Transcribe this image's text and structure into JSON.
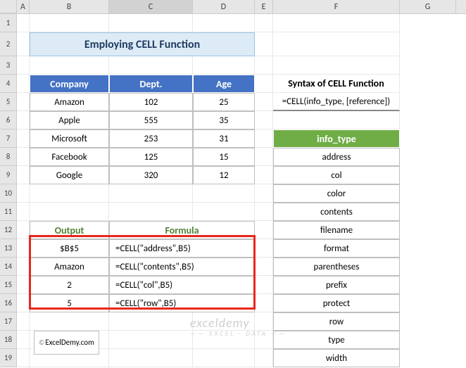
{
  "columns": [
    "A",
    "B",
    "C",
    "D",
    "E",
    "F",
    "G"
  ],
  "activeCol": "C",
  "rows": [
    "1",
    "2",
    "3",
    "4",
    "5",
    "6",
    "7",
    "8",
    "9",
    "10",
    "11",
    "12",
    "13",
    "14",
    "15",
    "16",
    "17",
    "18",
    "19"
  ],
  "title": "Employing CELL Function",
  "table1": {
    "headers": [
      "Company",
      "Dept.",
      "Age"
    ],
    "rows": [
      [
        "Amazon",
        "102",
        "25"
      ],
      [
        "Apple",
        "555",
        "35"
      ],
      [
        "Microsoft",
        "253",
        "31"
      ],
      [
        "Facebook",
        "125",
        "15"
      ],
      [
        "Google",
        "320",
        "12"
      ]
    ]
  },
  "syntax": {
    "title": "Syntax of CELL Function",
    "formula": "=CELL(info_type, [reference])"
  },
  "infoType": {
    "header": "info_type",
    "items": [
      "address",
      "col",
      "color",
      "contents",
      "filename",
      "format",
      "parentheses",
      "prefix",
      "protect",
      "row",
      "type",
      "width"
    ]
  },
  "table2": {
    "headers": [
      "Output",
      "Formula"
    ],
    "rows": [
      [
        "$B$5",
        "=CELL(\"address\",B5)"
      ],
      [
        "Amazon",
        "=CELL(\"contents\",B5)"
      ],
      [
        "2",
        "=CELL(\"col\",B5)"
      ],
      [
        "5",
        "=CELL(\"row\",B5)"
      ]
    ]
  },
  "footer": {
    "copyright": "©",
    "site": "ExcelDemy.com"
  },
  "watermark": {
    "main": "exceldemy",
    "sub": "—— EXCEL · DATA ——"
  }
}
